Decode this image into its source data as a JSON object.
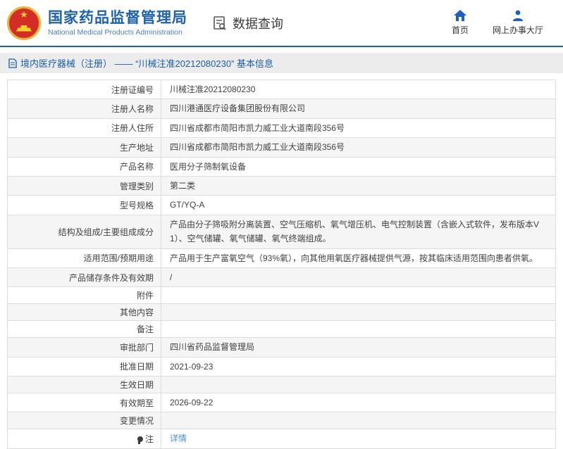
{
  "header": {
    "title": "国家药品监督管理局",
    "subtitle": "National Medical Products Administration",
    "section_label": "数据查询",
    "nav": [
      {
        "label": "首页",
        "icon": "home-icon"
      },
      {
        "label": "网上办事大厅",
        "icon": "person-icon"
      }
    ]
  },
  "breadcrumb": {
    "text": "境内医疗器械（注册） —— “川械注准20212080230” 基本信息",
    "icon": "document-icon"
  },
  "table": {
    "rows": [
      {
        "label": "注册证编号",
        "value": "川械注准20212080230"
      },
      {
        "label": "注册人名称",
        "value": "四川港通医疗设备集团股份有限公司"
      },
      {
        "label": "注册人住所",
        "value": "四川省成都市简阳市凯力威工业大道南段356号"
      },
      {
        "label": "生产地址",
        "value": "四川省成都市简阳市凯力威工业大道南段356号"
      },
      {
        "label": "产品名称",
        "value": "医用分子筛制氧设备"
      },
      {
        "label": "管理类别",
        "value": "第二类"
      },
      {
        "label": "型号规格",
        "value": "GT/YQ-A"
      },
      {
        "label": "结构及组成/主要组成成分",
        "value": "产品由分子筛吸附分离装置、空气压缩机、氧气增压机、电气控制装置（含嵌入式软件，发布版本V1）、空气储罐、氧气储罐、氧气终端组成。"
      },
      {
        "label": "适用范围/预期用途",
        "value": "产品用于生产富氧空气（93%氧），向其他用氧医疗器械提供气源，按其临床适用范围向患者供氧。"
      },
      {
        "label": "产品储存条件及有效期",
        "value": "/"
      },
      {
        "label": "附件",
        "value": ""
      },
      {
        "label": "其他内容",
        "value": ""
      },
      {
        "label": "备注",
        "value": ""
      },
      {
        "label": "审批部门",
        "value": "四川省药品监督管理局"
      },
      {
        "label": "批准日期",
        "value": "2021-09-23"
      },
      {
        "label": "生效日期",
        "value": ""
      },
      {
        "label": "有效期至",
        "value": "2026-09-22"
      },
      {
        "label": "变更情况",
        "value": ""
      },
      {
        "label": "注",
        "value": "详情",
        "value_is_link": true,
        "icon": "note-icon"
      }
    ]
  },
  "colors": {
    "header_border_blue": "#1b63a8",
    "title_blue": "#1e62ae",
    "breadcrumb_blue": "#1a5dab",
    "link_blue": "#4a90d9",
    "band_gray": "#ececec",
    "row_alt_gray": "#f5f5f5",
    "table_border": "#dddddd",
    "emblem_red": "#d42d26",
    "emblem_gold": "#e8b53a"
  }
}
